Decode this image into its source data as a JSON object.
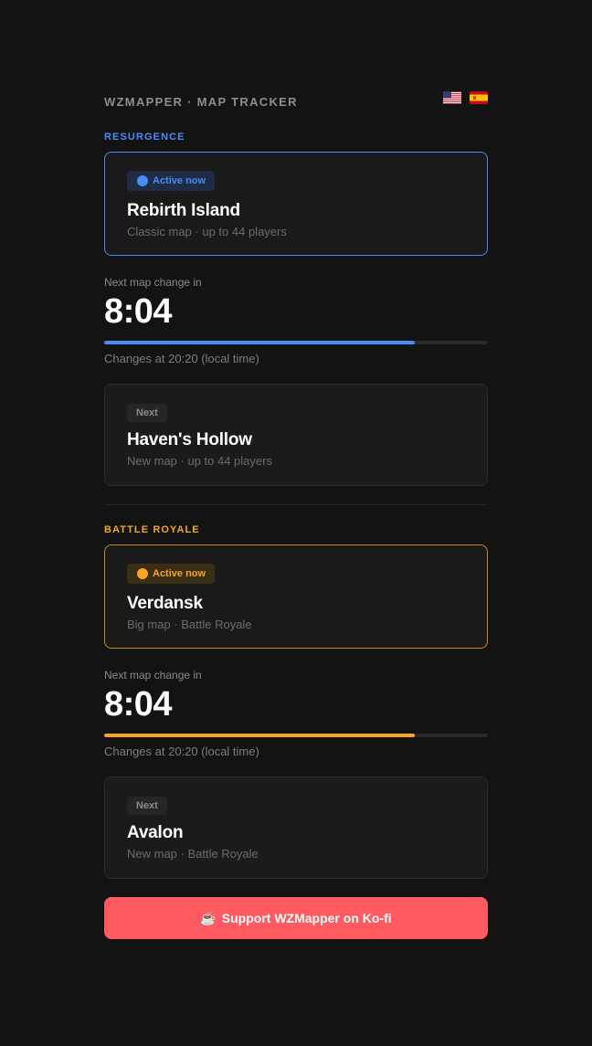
{
  "app": {
    "title": "WZMAPPER · MAP TRACKER",
    "languages": [
      "en-us-flag",
      "es-flag"
    ]
  },
  "colors": {
    "background": "#131313",
    "resurgence_accent": "#4a8cf5",
    "battle_royale_accent": "#f5a623",
    "kofi": "#ff5a5f"
  },
  "resurgence": {
    "label": "RESURGENCE",
    "active": {
      "badge": "Active now",
      "name": "Rebirth Island",
      "description": "Classic map · up to 44 players"
    },
    "timer": {
      "label": "Next map change in",
      "value": "8:04",
      "progress": 0.81,
      "changes_at": "Changes at 20:20 (local time)"
    },
    "next": {
      "badge": "Next",
      "name": "Haven's Hollow",
      "description": "New map · up to 44 players"
    }
  },
  "battle_royale": {
    "label": "BATTLE ROYALE",
    "active": {
      "badge": "Active now",
      "name": "Verdansk",
      "description": "Big map · Battle Royale"
    },
    "timer": {
      "label": "Next map change in",
      "value": "8:04",
      "progress": 0.81,
      "changes_at": "Changes at 20:20 (local time)"
    },
    "next": {
      "badge": "Next",
      "name": "Avalon",
      "description": "New map · Battle Royale"
    }
  },
  "support": {
    "icon": "coffee-icon",
    "label": "Support WZMapper on Ko-fi"
  }
}
